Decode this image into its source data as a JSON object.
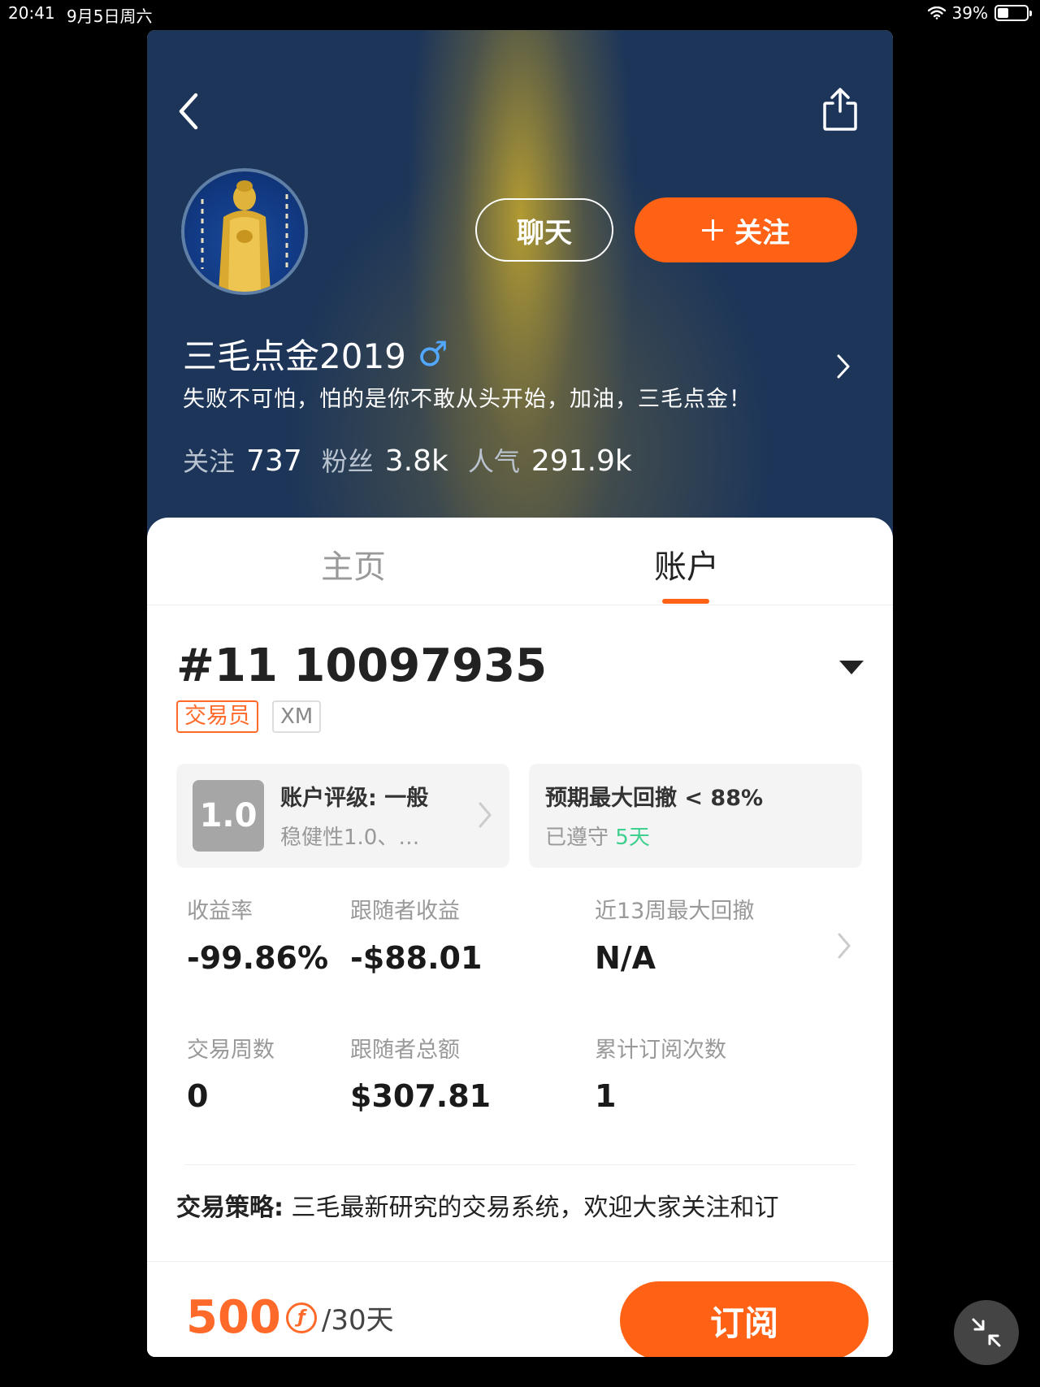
{
  "status_bar": {
    "time": "20:41",
    "date": "9月5日周六",
    "battery": "39%",
    "battery_level": 0.39
  },
  "header": {
    "back_icon": "chevron-left-icon",
    "share_icon": "share-icon"
  },
  "profile": {
    "chat_label": "聊天",
    "follow_label": "关注",
    "name": "三毛点金2019",
    "gender_symbol": "♂",
    "bio": "失败不可怕，怕的是你不敢从头开始，加油，三毛点金！",
    "stats": [
      {
        "label": "关注",
        "value": "737"
      },
      {
        "label": "粉丝",
        "value": "3.8k"
      },
      {
        "label": "人气",
        "value": "291.9k"
      }
    ]
  },
  "tabs": [
    {
      "label": "主页",
      "active": false
    },
    {
      "label": "账户",
      "active": true
    }
  ],
  "account": {
    "id": "#11 10097935",
    "tags": [
      "交易员",
      "XM"
    ],
    "rating": {
      "score": "1.0",
      "title": "账户评级: 一般",
      "subtitle": "稳健性1.0、…"
    },
    "drawdown": {
      "title": "预期最大回撤 < 88%",
      "subtitle_prefix": "已遵守",
      "days": "5天"
    },
    "metrics": [
      {
        "label": "收益率",
        "value": "-99.86%"
      },
      {
        "label": "跟随者收益",
        "value": "-$88.01"
      },
      {
        "label": "近13周最大回撤",
        "value": "N/A"
      },
      {
        "label": "交易周数",
        "value": "0"
      },
      {
        "label": "跟随者总额",
        "value": "$307.81"
      },
      {
        "label": "累计订阅次数",
        "value": "1"
      }
    ],
    "strategy_label": "交易策略:",
    "strategy_text": "三毛最新研究的交易系统，欢迎大家关注和订"
  },
  "subscription": {
    "price": "500",
    "currency_symbol": "ƒ",
    "period": "/30天",
    "subscribe_label": "订阅"
  },
  "colors": {
    "accent": "#ff6214",
    "header_bg": "#1c3559",
    "positive": "#3fcf8e"
  }
}
